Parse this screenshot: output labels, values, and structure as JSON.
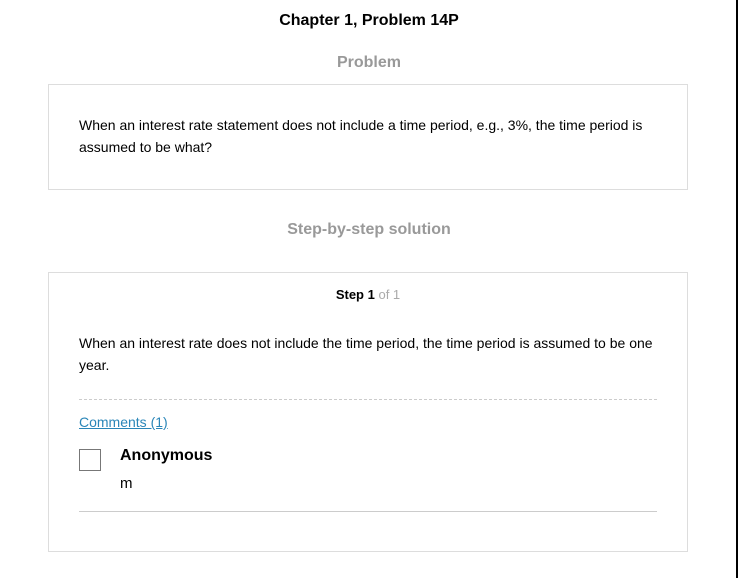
{
  "header": {
    "title": "Chapter 1, Problem 14P"
  },
  "problem": {
    "heading": "Problem",
    "text": "When an interest rate statement does not include a time period, e.g., 3%, the time period is assumed to be what?"
  },
  "solution": {
    "heading": "Step-by-step solution",
    "step_label": "Step 1",
    "step_of": "of 1",
    "text": "When an interest rate does not include the time period, the time period is assumed to be one year.",
    "comments_link": "Comments (1)",
    "comments": [
      {
        "author": "Anonymous",
        "text": "m"
      }
    ]
  },
  "colors": {
    "link": "#2a86b8",
    "muted": "#999999"
  }
}
